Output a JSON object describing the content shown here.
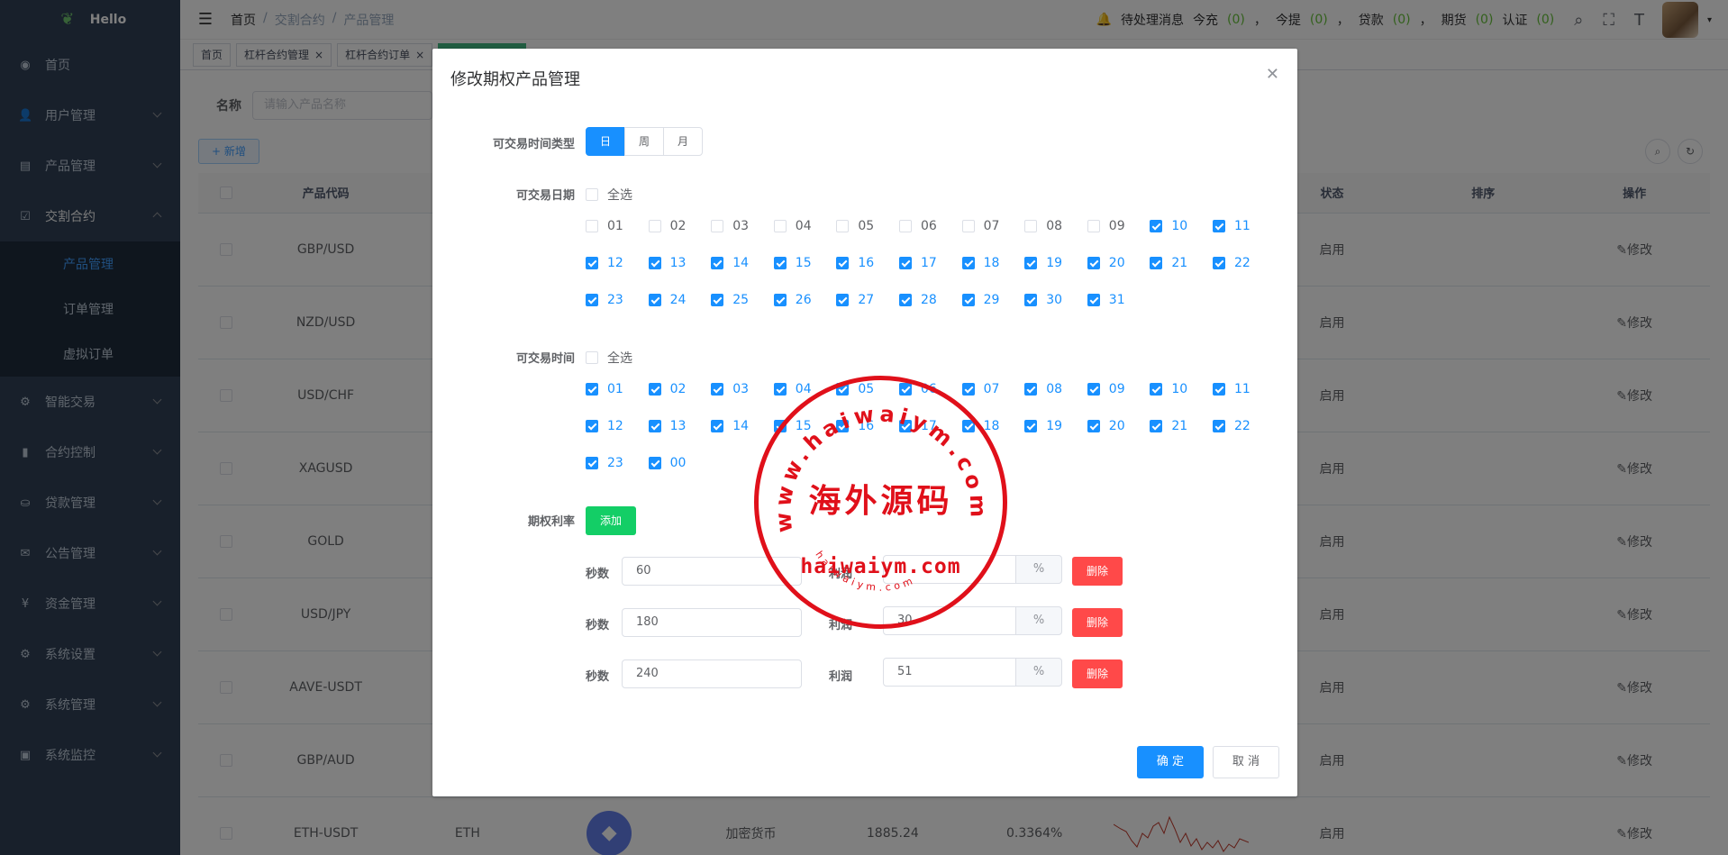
{
  "app": {
    "logo": "Hello"
  },
  "sidebar": {
    "items": [
      {
        "label": "首页",
        "icon": "dashboard-icon"
      },
      {
        "label": "用户管理",
        "icon": "user-icon"
      },
      {
        "label": "产品管理",
        "icon": "product-icon"
      },
      {
        "label": "交割合约",
        "icon": "contract-icon"
      },
      {
        "label": "智能交易",
        "icon": "gear-icon"
      },
      {
        "label": "合约控制",
        "icon": "chart-icon"
      },
      {
        "label": "贷款管理",
        "icon": "loan-icon"
      },
      {
        "label": "公告管理",
        "icon": "message-icon"
      },
      {
        "label": "资金管理",
        "icon": "money-icon"
      },
      {
        "label": "系统设置",
        "icon": "gear-icon"
      },
      {
        "label": "系统管理",
        "icon": "gear-icon"
      },
      {
        "label": "系统监控",
        "icon": "monitor-icon"
      }
    ],
    "subitems": [
      "产品管理",
      "订单管理",
      "虚拟订单"
    ]
  },
  "navbar": {
    "breadcrumb": [
      "首页",
      "交割合约",
      "产品管理"
    ],
    "pending_label": "待处理消息",
    "today_recharge": "今充",
    "today_recharge_count": "(0)",
    "withdraw": "今提",
    "withdraw_count": "(0)",
    "loan": "贷款",
    "loan_count": "(0)",
    "futures": "期货",
    "futures_count": "(0)",
    "auth": "认证",
    "auth_count": "(0)",
    "sep": "，"
  },
  "tags": [
    {
      "label": "首页"
    },
    {
      "label": "杠杆合约管理"
    },
    {
      "label": "杠杆合约订单"
    }
  ],
  "filter": {
    "name_label": "名称",
    "name_placeholder": "请输入产品名称"
  },
  "toolbar": {
    "add_label": "+ 新增"
  },
  "table": {
    "headers": {
      "code": "产品代码",
      "status": "状态",
      "sort": "排序",
      "op": "操作"
    },
    "rows": [
      {
        "code": "GBP/USD",
        "status": "启用",
        "op": "✎修改"
      },
      {
        "code": "NZD/USD",
        "status": "启用",
        "op": "✎修改"
      },
      {
        "code": "USD/CHF",
        "status": "启用",
        "op": "✎修改"
      },
      {
        "code": "XAGUSD",
        "status": "启用",
        "op": "✎修改"
      },
      {
        "code": "GOLD",
        "status": "启用",
        "op": "✎修改"
      },
      {
        "code": "USD/JPY",
        "status": "启用",
        "op": "✎修改"
      },
      {
        "code": "AAVE-USDT",
        "status": "启用",
        "op": "✎修改"
      },
      {
        "code": "GBP/AUD",
        "status": "启用",
        "op": "✎修改"
      },
      {
        "code": "ETH-USDT",
        "coin": "ETH",
        "type": "加密货币",
        "price": "1885.24",
        "change": "0.3364%",
        "status": "启用",
        "op": "✎修改"
      }
    ]
  },
  "dialog": {
    "title": "修改期权产品管理",
    "time_type_label": "可交易时间类型",
    "time_types": [
      "日",
      "周",
      "月"
    ],
    "selected_time_type": "日",
    "date_label": "可交易日期",
    "select_all": "全选",
    "dates": [
      "01",
      "02",
      "03",
      "04",
      "05",
      "06",
      "07",
      "08",
      "09",
      "10",
      "11",
      "12",
      "13",
      "14",
      "15",
      "16",
      "17",
      "18",
      "19",
      "20",
      "21",
      "22",
      "23",
      "24",
      "25",
      "26",
      "27",
      "28",
      "29",
      "30",
      "31"
    ],
    "dates_checked": [
      "10",
      "11",
      "12",
      "13",
      "14",
      "15",
      "16",
      "17",
      "18",
      "19",
      "20",
      "21",
      "22",
      "23",
      "24",
      "25",
      "26",
      "27",
      "28",
      "29",
      "30",
      "31"
    ],
    "hours_label": "可交易时间",
    "hours": [
      "01",
      "02",
      "03",
      "04",
      "05",
      "06",
      "07",
      "08",
      "09",
      "10",
      "11",
      "12",
      "13",
      "14",
      "15",
      "16",
      "17",
      "18",
      "19",
      "20",
      "21",
      "22",
      "23",
      "00"
    ],
    "rate_label": "期权利率",
    "add_label": "添加",
    "seconds_label": "秒数",
    "profit_label": "利润",
    "percent": "%",
    "delete_label": "删除",
    "rates": [
      {
        "seconds": "60",
        "profit": ""
      },
      {
        "seconds": "180",
        "profit": "30"
      },
      {
        "seconds": "240",
        "profit": "51"
      }
    ],
    "confirm": "确 定",
    "cancel": "取 消"
  },
  "watermark": {
    "outer_text": "www.haiwaiym.com",
    "center_text": "海外源码",
    "domain_text": "haiwaiym.com",
    "small_text": "haiwaiym.com",
    "color": "#e0101a"
  },
  "colors": {
    "primary": "#1890ff",
    "success": "#13ce66",
    "danger": "#ff4949",
    "sidebar": "#304156"
  }
}
